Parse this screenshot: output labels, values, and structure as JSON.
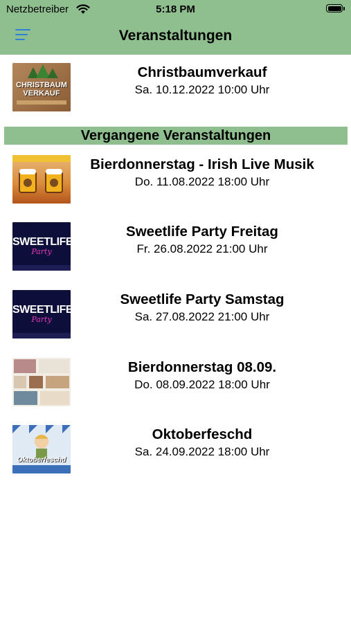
{
  "status_bar": {
    "carrier": "Netzbetreiber",
    "time": "5:18 PM"
  },
  "nav": {
    "title": "Veranstaltungen",
    "menu_icon": "menu-icon"
  },
  "upcoming": [
    {
      "title": "Christbaumverkauf",
      "date": "Sa. 10.12.2022 10:00 Uhr",
      "thumb_text": "CHRISTBAUM VERKAUF"
    }
  ],
  "past_section": {
    "title": "Vergangene Veranstaltungen"
  },
  "past": [
    {
      "title": "Bierdonnerstag - Irish Live Musik",
      "date": "Do. 11.08.2022 18:00 Uhr"
    },
    {
      "title": "Sweetlife Party Freitag",
      "date": "Fr. 26.08.2022 21:00 Uhr",
      "thumb_text": "SWEETLIFE",
      "thumb_sub": "Party"
    },
    {
      "title": "Sweetlife Party Samstag",
      "date": "Sa. 27.08.2022 21:00 Uhr",
      "thumb_text": "SWEETLIFE",
      "thumb_sub": "Party"
    },
    {
      "title": "Bierdonnerstag 08.09.",
      "date": "Do. 08.09.2022 18:00 Uhr"
    },
    {
      "title": "Oktoberfeschd",
      "date": "Sa. 24.09.2022 18:00 Uhr",
      "thumb_text": "Oktoberfeschd"
    }
  ],
  "colors": {
    "header_bg": "#8fbf8f",
    "accent": "#2f7fd8"
  }
}
